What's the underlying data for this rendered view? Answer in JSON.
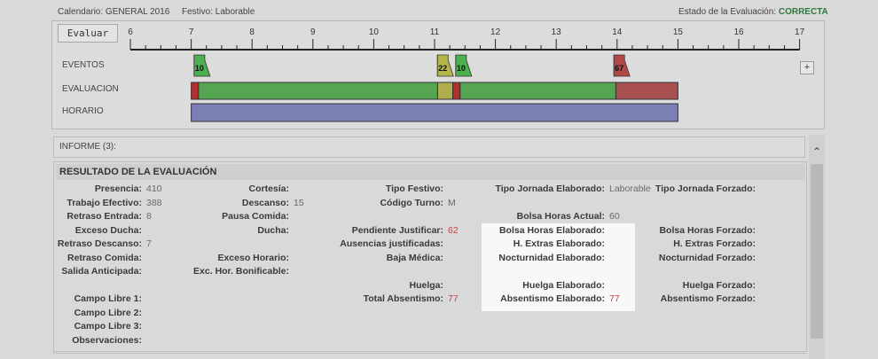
{
  "header": {
    "calendario": "Calendario: GENERAL 2016",
    "festivo": "Festivo: Laborable",
    "estado_label": "Estado de la Evaluación:",
    "estado_value": "CORRECTA"
  },
  "toolbar": {
    "evaluar_label": "Evaluar",
    "expand_label": "+"
  },
  "timeline": {
    "ticks": [
      "6",
      "7",
      "8",
      "9",
      "10",
      "11",
      "12",
      "13",
      "14",
      "15",
      "16",
      "17"
    ],
    "rows": [
      "EVENTOS",
      "EVALUACION",
      "HORARIO"
    ],
    "events": [
      {
        "hour": 7.15,
        "label": "10",
        "color": "#4caf50"
      },
      {
        "hour": 11.15,
        "label": "22",
        "color": "#b5b54a"
      },
      {
        "hour": 11.45,
        "label": "10",
        "color": "#4caf50"
      },
      {
        "hour": 14.05,
        "label": "67",
        "color": "#b04848"
      }
    ],
    "evaluacion": [
      {
        "from": 7.0,
        "to": 7.12,
        "color": "#b03030"
      },
      {
        "from": 7.12,
        "to": 11.05,
        "color": "#55a553"
      },
      {
        "from": 11.05,
        "to": 11.3,
        "color": "#b1ac4c"
      },
      {
        "from": 11.3,
        "to": 11.42,
        "color": "#b03030"
      },
      {
        "from": 11.42,
        "to": 13.98,
        "color": "#55a553"
      },
      {
        "from": 13.98,
        "to": 15.0,
        "color": "#a85050"
      }
    ],
    "horario": [
      {
        "from": 7.0,
        "to": 15.0,
        "color": "#7b7fb4"
      }
    ]
  },
  "informe": {
    "title": "INFORME (3):"
  },
  "resultado": {
    "title": "RESULTADO DE LA EVALUACIÓN",
    "col1": [
      {
        "label": "Presencia:",
        "value": "410"
      },
      {
        "label": "Trabajo Efectivo:",
        "value": "388"
      },
      {
        "label": "Retraso Entrada:",
        "value": "8"
      },
      {
        "label": "Exceso Ducha:",
        "value": ""
      },
      {
        "label": "Retraso Descanso:",
        "value": "7"
      },
      {
        "label": "Retraso Comida:",
        "value": ""
      },
      {
        "label": "Salida Anticipada:",
        "value": ""
      },
      {
        "label": "Campo Libre 1:",
        "value": ""
      },
      {
        "label": "Campo Libre 2:",
        "value": ""
      },
      {
        "label": "Campo Libre 3:",
        "value": ""
      },
      {
        "label": "Observaciones:",
        "value": ""
      }
    ],
    "col2": [
      {
        "label": "Cortesía:",
        "value": ""
      },
      {
        "label": "Descanso:",
        "value": "15"
      },
      {
        "label": "Pausa Comida:",
        "value": ""
      },
      {
        "label": "Ducha:",
        "value": ""
      },
      {
        "label": "Exceso Horario:",
        "value": ""
      },
      {
        "label": "Exc. Hor. Bonificable:",
        "value": ""
      }
    ],
    "col3": [
      {
        "label": "Tipo Festivo:",
        "value": ""
      },
      {
        "label": "Código Turno:",
        "value": "M"
      },
      {
        "label": "Pendiente Justificar:",
        "value": "62"
      },
      {
        "label": "Ausencias justificadas:",
        "value": ""
      },
      {
        "label": "Baja Médica:",
        "value": ""
      },
      {
        "label": "Huelga:",
        "value": ""
      },
      {
        "label": "Total Absentismo:",
        "value": "77"
      }
    ],
    "col4": [
      {
        "label": "Tipo Jornada Elaborado:",
        "value": "Laborable"
      },
      {
        "label": "Bolsa Horas Actual:",
        "value": "60"
      },
      {
        "label": "Bolsa Horas Elaborado:",
        "value": ""
      },
      {
        "label": "H. Extras Elaborado:",
        "value": ""
      },
      {
        "label": "Nocturnidad Elaborado:",
        "value": ""
      },
      {
        "label": "Huelga Elaborado:",
        "value": ""
      },
      {
        "label": "Absentismo Elaborado:",
        "value": "77"
      }
    ],
    "col5": [
      {
        "label": "Tipo Jornada Forzado:",
        "value": ""
      },
      {
        "label": "Bolsa Horas Forzado:",
        "value": ""
      },
      {
        "label": "H. Extras Forzado:",
        "value": ""
      },
      {
        "label": "Nocturnidad Forzado:",
        "value": ""
      },
      {
        "label": "Huelga Forzado:",
        "value": ""
      },
      {
        "label": "Absentismo Forzado:",
        "value": ""
      }
    ]
  }
}
